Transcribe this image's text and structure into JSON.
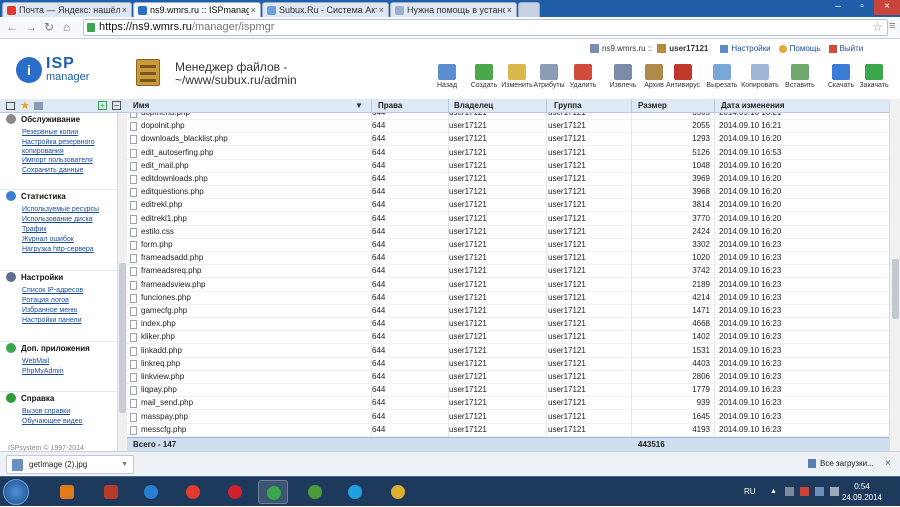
{
  "browser": {
    "tabs": [
      {
        "label": "Почта — Яндекс: нашёлся",
        "icon": "yandex-mail-icon",
        "active": false
      },
      {
        "label": "ns9.wmrs.ru :: ISPmanager",
        "icon": "ispmanager-icon",
        "active": true
      },
      {
        "label": "Subux.Ru - Система Акти",
        "icon": "subux-icon",
        "active": false
      },
      {
        "label": "Нужна помощь в устано",
        "icon": "forum-icon",
        "active": false
      }
    ],
    "url_host": "https://ns9.wmrs.ru",
    "url_path": "/manager/ispmgr"
  },
  "userbar": {
    "server": "ns9.wmrs.ru ::",
    "user": "user17121",
    "settings": "Настройки",
    "help": "Помощь",
    "logout": "Выйти"
  },
  "header": {
    "logo_top": "ISP",
    "logo_bottom": "manager",
    "title": "Менеджер файлов - ~/www/subux.ru/admin"
  },
  "toolbar": [
    {
      "label": "Назад",
      "icon": "back-arrow-icon",
      "color": "#5b8fd1"
    },
    {
      "label": "Создать",
      "icon": "create-file-icon",
      "color": "#4aa84a"
    },
    {
      "label": "Изменить",
      "icon": "edit-icon",
      "color": "#d9b84a"
    },
    {
      "label": "Атрибуты",
      "icon": "attributes-icon",
      "color": "#8a9bb3"
    },
    {
      "label": "Удалить",
      "icon": "delete-icon",
      "color": "#d24a3a"
    },
    {
      "label": "Извлечь",
      "icon": "extract-icon",
      "color": "#7b8da6"
    },
    {
      "label": "Архив",
      "icon": "archive-icon",
      "color": "#b08a4a"
    },
    {
      "label": "Антивирус",
      "icon": "antivirus-icon",
      "color": "#c0392b"
    },
    {
      "label": "Вырезать",
      "icon": "cut-icon",
      "color": "#7aa7d9"
    },
    {
      "label": "Копировать",
      "icon": "copy-icon",
      "color": "#9fb6d6"
    },
    {
      "label": "Вставить",
      "icon": "paste-icon",
      "color": "#6fa76f"
    },
    {
      "label": "Скачать",
      "icon": "download-icon",
      "color": "#3a7bd5"
    },
    {
      "label": "Закачать",
      "icon": "upload-icon",
      "color": "#3aa84a"
    }
  ],
  "columns": {
    "name": "Имя",
    "perms": "Права",
    "owner": "Владелец",
    "group": "Группа",
    "size": "Размер",
    "mtime": "Дата изменения"
  },
  "files": [
    {
      "name": "dopmenu.php",
      "perms": "644",
      "owner": "user17121",
      "group": "user17121",
      "size": "3505",
      "mtime": "2014.09.10 16:21"
    },
    {
      "name": "dopolnit.php",
      "perms": "644",
      "owner": "user17121",
      "group": "user17121",
      "size": "2055",
      "mtime": "2014.09.10 16:21"
    },
    {
      "name": "downloads_blacklist.php",
      "perms": "644",
      "owner": "user17121",
      "group": "user17121",
      "size": "1293",
      "mtime": "2014.09.10 16:20"
    },
    {
      "name": "edit_autoserfing.php",
      "perms": "644",
      "owner": "user17121",
      "group": "user17121",
      "size": "5126",
      "mtime": "2014.09.10 16:53"
    },
    {
      "name": "edit_mail.php",
      "perms": "644",
      "owner": "user17121",
      "group": "user17121",
      "size": "1048",
      "mtime": "2014.09.10 16:20"
    },
    {
      "name": "editdownloads.php",
      "perms": "644",
      "owner": "user17121",
      "group": "user17121",
      "size": "3969",
      "mtime": "2014.09.10 16:20"
    },
    {
      "name": "editquestions.php",
      "perms": "644",
      "owner": "user17121",
      "group": "user17121",
      "size": "3968",
      "mtime": "2014.09.10 16:20"
    },
    {
      "name": "editrekl.php",
      "perms": "644",
      "owner": "user17121",
      "group": "user17121",
      "size": "3814",
      "mtime": "2014.09.10 16:20"
    },
    {
      "name": "editrekl1.php",
      "perms": "644",
      "owner": "user17121",
      "group": "user17121",
      "size": "3770",
      "mtime": "2014.09.10 16:20"
    },
    {
      "name": "estilo.css",
      "perms": "644",
      "owner": "user17121",
      "group": "user17121",
      "size": "2424",
      "mtime": "2014.09.10 16:20"
    },
    {
      "name": "form.php",
      "perms": "644",
      "owner": "user17121",
      "group": "user17121",
      "size": "3302",
      "mtime": "2014.09.10 16:23"
    },
    {
      "name": "frameadsadd.php",
      "perms": "644",
      "owner": "user17121",
      "group": "user17121",
      "size": "1020",
      "mtime": "2014.09.10 16:23"
    },
    {
      "name": "frameadsreq.php",
      "perms": "644",
      "owner": "user17121",
      "group": "user17121",
      "size": "3742",
      "mtime": "2014.09.10 16:23"
    },
    {
      "name": "frameadsview.php",
      "perms": "644",
      "owner": "user17121",
      "group": "user17121",
      "size": "2189",
      "mtime": "2014.09.10 16:23"
    },
    {
      "name": "funciones.php",
      "perms": "644",
      "owner": "user17121",
      "group": "user17121",
      "size": "4214",
      "mtime": "2014.09.10 16:23"
    },
    {
      "name": "gamecfg.php",
      "perms": "644",
      "owner": "user17121",
      "group": "user17121",
      "size": "1471",
      "mtime": "2014.09.10 16:23"
    },
    {
      "name": "index.php",
      "perms": "644",
      "owner": "user17121",
      "group": "user17121",
      "size": "4668",
      "mtime": "2014.09.10 16:23"
    },
    {
      "name": "kliker.php",
      "perms": "644",
      "owner": "user17121",
      "group": "user17121",
      "size": "1402",
      "mtime": "2014.09.10 16:23"
    },
    {
      "name": "linkadd.php",
      "perms": "644",
      "owner": "user17121",
      "group": "user17121",
      "size": "1531",
      "mtime": "2014.09.10 16:23"
    },
    {
      "name": "linkreq.php",
      "perms": "644",
      "owner": "user17121",
      "group": "user17121",
      "size": "4403",
      "mtime": "2014.09.10 16:23"
    },
    {
      "name": "linkview.php",
      "perms": "644",
      "owner": "user17121",
      "group": "user17121",
      "size": "2806",
      "mtime": "2014.09.10 16:23"
    },
    {
      "name": "liqpay.php",
      "perms": "644",
      "owner": "user17121",
      "group": "user17121",
      "size": "1779",
      "mtime": "2014.09.10 16:23"
    },
    {
      "name": "mail_send.php",
      "perms": "644",
      "owner": "user17121",
      "group": "user17121",
      "size": "939",
      "mtime": "2014.09.10 16:23"
    },
    {
      "name": "masspay.php",
      "perms": "644",
      "owner": "user17121",
      "group": "user17121",
      "size": "1645",
      "mtime": "2014.09.10 16:23"
    },
    {
      "name": "messcfg.php",
      "perms": "644",
      "owner": "user17121",
      "group": "user17121",
      "size": "4193",
      "mtime": "2014.09.10 16:23"
    }
  ],
  "footer": {
    "total_label": "Всего - 147",
    "total_size": "443516"
  },
  "sidebar": {
    "groups": [
      {
        "title": "Обслуживание",
        "icon": "maintenance-icon",
        "color": "#8a8a8a",
        "links": [
          "Резервные копии",
          "Настройка резервного копирования",
          "Импорт пользователя",
          "Сохранить данные"
        ]
      },
      {
        "title": "Статистика",
        "icon": "statistics-icon",
        "color": "#3b7fd1",
        "links": [
          "Используемые ресурсы",
          "Использование диска",
          "Трафик",
          "Журнал ошибок",
          "Нагрузка http-сервера"
        ]
      },
      {
        "title": "Настройки",
        "icon": "settings-icon",
        "color": "#5d6f8a",
        "links": [
          "Список IP-адресов",
          "Ротация логов",
          "Избранное меню",
          "Настройки панели"
        ]
      },
      {
        "title": "Доп. приложения",
        "icon": "addons-icon",
        "color": "#3aa84a",
        "links": [
          "WebMail",
          "PhpMyAdmin"
        ]
      },
      {
        "title": "Справка",
        "icon": "help-book-icon",
        "color": "#2e9a3a",
        "links": [
          "Вызов справки",
          "Обучающее видео"
        ]
      }
    ],
    "copyright": "ISPsystem © 1997-2014"
  },
  "downloads": {
    "file": "getImage (2).jpg",
    "show_all": "Все загрузки..."
  },
  "taskbar": {
    "lang": "RU",
    "time": "0:54",
    "date": "24.09.2014"
  }
}
